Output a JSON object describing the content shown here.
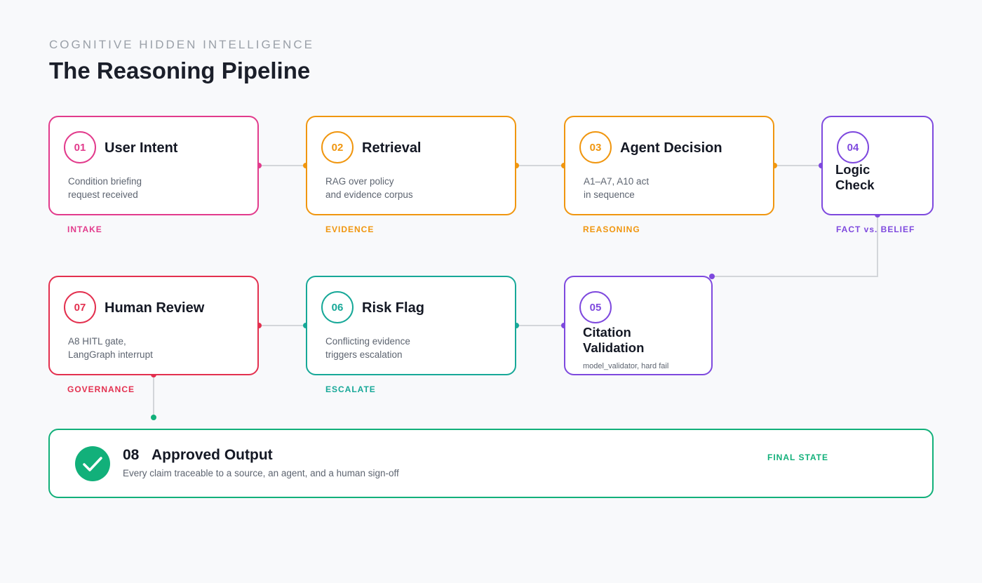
{
  "header": {
    "eyebrow": "COGNITIVE HIDDEN INTELLIGENCE",
    "title": "The Reasoning Pipeline"
  },
  "colors": {
    "pink": "#e23b8c",
    "orange": "#f0960f",
    "purple": "#7e49de",
    "red": "#e3304f",
    "teal": "#17a898",
    "green": "#12b07a",
    "connector": "#d3d6da"
  },
  "steps": [
    {
      "number": "01",
      "title": "User Intent",
      "desc": "Condition briefing\nrequest received",
      "tag": "INTAKE"
    },
    {
      "number": "02",
      "title": "Retrieval",
      "desc": "RAG over policy\nand evidence corpus",
      "tag": "EVIDENCE"
    },
    {
      "number": "03",
      "title": "Agent Decision",
      "desc": "A1–A7, A10 act\nin sequence",
      "tag": "REASONING"
    },
    {
      "number": "04",
      "title": "Logic\nCheck",
      "desc": "",
      "tag": "FACT vs. BELIEF"
    },
    {
      "number": "05",
      "title": "Citation\nValidation",
      "desc": "model_validator, hard fail",
      "tag": ""
    },
    {
      "number": "06",
      "title": "Risk Flag",
      "desc": "Conflicting evidence\ntriggers escalation",
      "tag": "ESCALATE"
    },
    {
      "number": "07",
      "title": "Human Review",
      "desc": "A8 HITL gate,\nLangGraph interrupt",
      "tag": "GOVERNANCE"
    }
  ],
  "final": {
    "number": "08",
    "title": "Approved Output",
    "desc": "Every claim traceable to a source, an agent, and a human sign-off",
    "tag": "FINAL STATE",
    "icon": "check-circle-icon"
  }
}
